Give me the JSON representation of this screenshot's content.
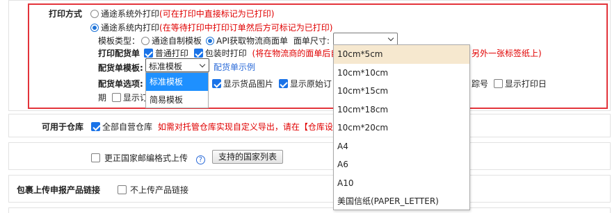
{
  "print_mode": {
    "label": "打印方式",
    "option1_label": "通途系统外打印",
    "option1_note": "(可在打印中直接标记为已打印)",
    "option2_label": "通途系统内打印",
    "option2_note": "(在等待打印中打印订单然后方可标记为已打印)"
  },
  "template_type": {
    "label": "模板类型：",
    "option1_label": "通途自制模板",
    "option2_label": "API获取物流商面单",
    "size_label": "面单尺寸:",
    "size_value": ""
  },
  "print_delivery": {
    "label": "打印配货单",
    "normal_print_label": "普通打印",
    "pack_print_label": "包装时打印",
    "note_part1": "(将在物流商的面单后自",
    "note_part2": "另外一张标签纸上)"
  },
  "delivery_template": {
    "label": "配货单模板:",
    "selected": "标准模板",
    "example_link": "配货单示例",
    "options": [
      "标准模板",
      "简易模板"
    ]
  },
  "delivery_options": {
    "label": "配货单选项:",
    "show_product_image": "显示货品图片",
    "show_original_order": "显示原始订",
    "tracking_suffix": "踪号",
    "show_print_date_line1": "显示打印日",
    "show_print_date_line2": "期",
    "show_order_trunc": "显示订"
  },
  "label_size_options": [
    "10cm*5cm",
    "10cm*10cm",
    "10cm*15cm",
    "10cm*18cm",
    "10cm*20cm",
    "A4",
    "A6",
    "A10",
    "美国信纸(PAPER_LETTER)"
  ],
  "warehouse": {
    "label": "可用于仓库",
    "all_label": "全部自营仓库",
    "note": "如需对托管仓库实现自定义导出，请在【仓库设"
  },
  "postal": {
    "label": "更正国家邮编格式上传",
    "help": "?",
    "button": "支持的国家列表"
  },
  "package_upload": {
    "label": "包裹上传申报产品链接",
    "option_label": "不上传产品链接"
  },
  "colors": {
    "accent": "#1a73e8",
    "highlight_border": "#e3333a",
    "note_red": "#e00000",
    "link_blue": "#2a6ad8"
  }
}
